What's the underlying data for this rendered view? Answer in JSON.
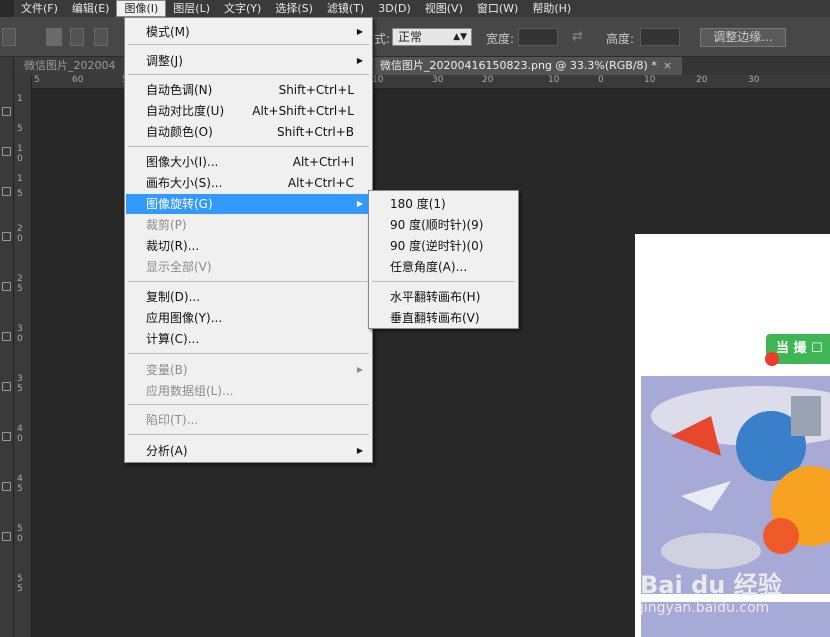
{
  "menubar": {
    "items": [
      "文件(F)",
      "编辑(E)",
      "图像(I)",
      "图层(L)",
      "文字(Y)",
      "选择(S)",
      "滤镜(T)",
      "3D(D)",
      "视图(V)",
      "窗口(W)",
      "帮助(H)"
    ],
    "active_index": 2
  },
  "options": {
    "style_label": "式:",
    "style_value": "正常",
    "width_label": "宽度:",
    "height_label": "高度:",
    "refine_button": "调整边缘..."
  },
  "tabs": [
    {
      "label": "微信图片_202004",
      "active": false
    },
    {
      "label": "微信图片_20200416150823.png @ 33.3%(RGB/8) *",
      "active": true,
      "close": "×"
    }
  ],
  "ruler": {
    "h_ticks": [
      "5",
      "60",
      "5",
      "10",
      "30",
      "20",
      "10",
      "0",
      "10",
      "20",
      "30"
    ],
    "v_ticks": [
      "1",
      "5",
      "1",
      "0",
      "1",
      "5",
      "2",
      "0",
      "2",
      "5",
      "3",
      "0",
      "3",
      "5",
      "4",
      "0",
      "4",
      "5",
      "5",
      "0",
      "5",
      "5"
    ]
  },
  "image_menu": {
    "items": [
      {
        "label": "模式(M)",
        "shortcut": "",
        "submenu": true,
        "disabled": false
      },
      {
        "label": "调整(J)",
        "shortcut": "",
        "submenu": true,
        "disabled": false
      },
      {
        "label": "自动色调(N)",
        "shortcut": "Shift+Ctrl+L",
        "submenu": false,
        "disabled": false
      },
      {
        "label": "自动对比度(U)",
        "shortcut": "Alt+Shift+Ctrl+L",
        "submenu": false,
        "disabled": false
      },
      {
        "label": "自动颜色(O)",
        "shortcut": "Shift+Ctrl+B",
        "submenu": false,
        "disabled": false
      },
      {
        "label": "图像大小(I)...",
        "shortcut": "Alt+Ctrl+I",
        "submenu": false,
        "disabled": false
      },
      {
        "label": "画布大小(S)...",
        "shortcut": "Alt+Ctrl+C",
        "submenu": false,
        "disabled": false
      },
      {
        "label": "图像旋转(G)",
        "shortcut": "",
        "submenu": true,
        "disabled": false,
        "highlighted": true
      },
      {
        "label": "裁剪(P)",
        "shortcut": "",
        "submenu": false,
        "disabled": true
      },
      {
        "label": "裁切(R)...",
        "shortcut": "",
        "submenu": false,
        "disabled": false
      },
      {
        "label": "显示全部(V)",
        "shortcut": "",
        "submenu": false,
        "disabled": true
      },
      {
        "label": "复制(D)...",
        "shortcut": "",
        "submenu": false,
        "disabled": false
      },
      {
        "label": "应用图像(Y)...",
        "shortcut": "",
        "submenu": false,
        "disabled": false
      },
      {
        "label": "计算(C)...",
        "shortcut": "",
        "submenu": false,
        "disabled": false
      },
      {
        "label": "变量(B)",
        "shortcut": "",
        "submenu": true,
        "disabled": true
      },
      {
        "label": "应用数据组(L)...",
        "shortcut": "",
        "submenu": false,
        "disabled": true
      },
      {
        "label": "陷印(T)...",
        "shortcut": "",
        "submenu": false,
        "disabled": true
      },
      {
        "label": "分析(A)",
        "shortcut": "",
        "submenu": true,
        "disabled": false
      }
    ]
  },
  "rotate_submenu": {
    "items": [
      "180 度(1)",
      "90 度(顺时针)(9)",
      "90 度(逆时针)(0)",
      "任意角度(A)...",
      "水平翻转画布(H)",
      "垂直翻转画布(V)"
    ]
  },
  "document": {
    "button_text": "当 撮 ☐",
    "watermark": "Bai du 经验",
    "watermark_url": "jingyan.baidu.com"
  }
}
